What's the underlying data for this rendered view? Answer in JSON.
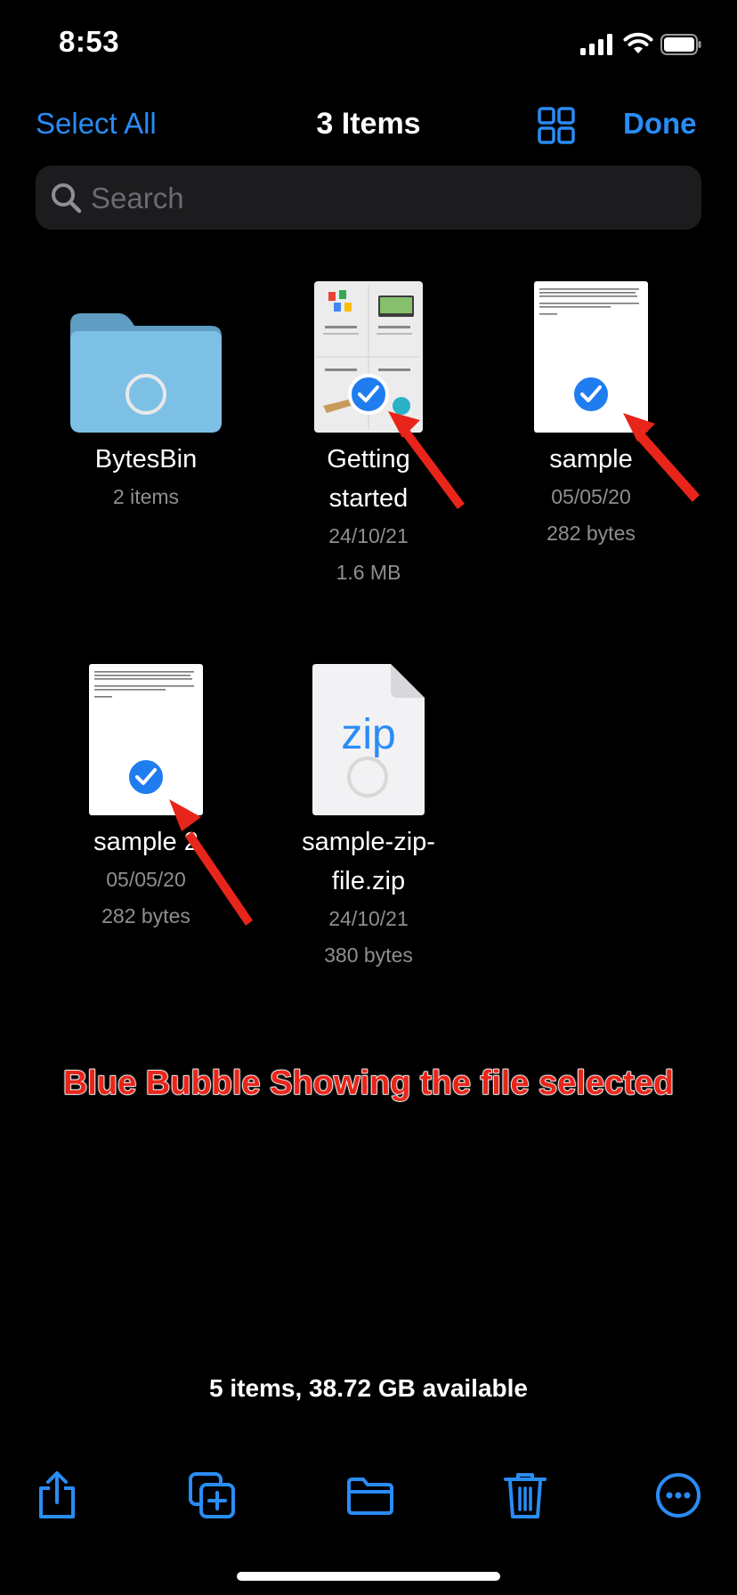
{
  "status_bar": {
    "time": "8:53"
  },
  "nav": {
    "select_all": "Select All",
    "title": "3 Items",
    "done": "Done"
  },
  "search": {
    "placeholder": "Search"
  },
  "items": [
    {
      "name": "BytesBin",
      "meta1": "2 items",
      "meta2": "",
      "selected": false
    },
    {
      "name": "Getting started",
      "meta1": "24/10/21",
      "meta2": "1.6 MB",
      "selected": true
    },
    {
      "name": "sample",
      "meta1": "05/05/20",
      "meta2": "282 bytes",
      "selected": true
    },
    {
      "name": "sample 2",
      "meta1": "05/05/20",
      "meta2": "282 bytes",
      "selected": true
    },
    {
      "name": "sample-zip-file.zip",
      "meta1": "24/10/21",
      "meta2": "380 bytes",
      "selected": false
    }
  ],
  "zip_label": "zip",
  "annotation": "Blue Bubble Showing the file selected",
  "footer": {
    "summary": "5 items, 38.72 GB available"
  },
  "toolbar": [
    "share-icon",
    "duplicate-icon",
    "folder-icon",
    "trash-icon",
    "more-icon"
  ],
  "colors": {
    "accent": "#2a8cf5",
    "check": "#1f7df0",
    "annotation": "#e8251a"
  }
}
